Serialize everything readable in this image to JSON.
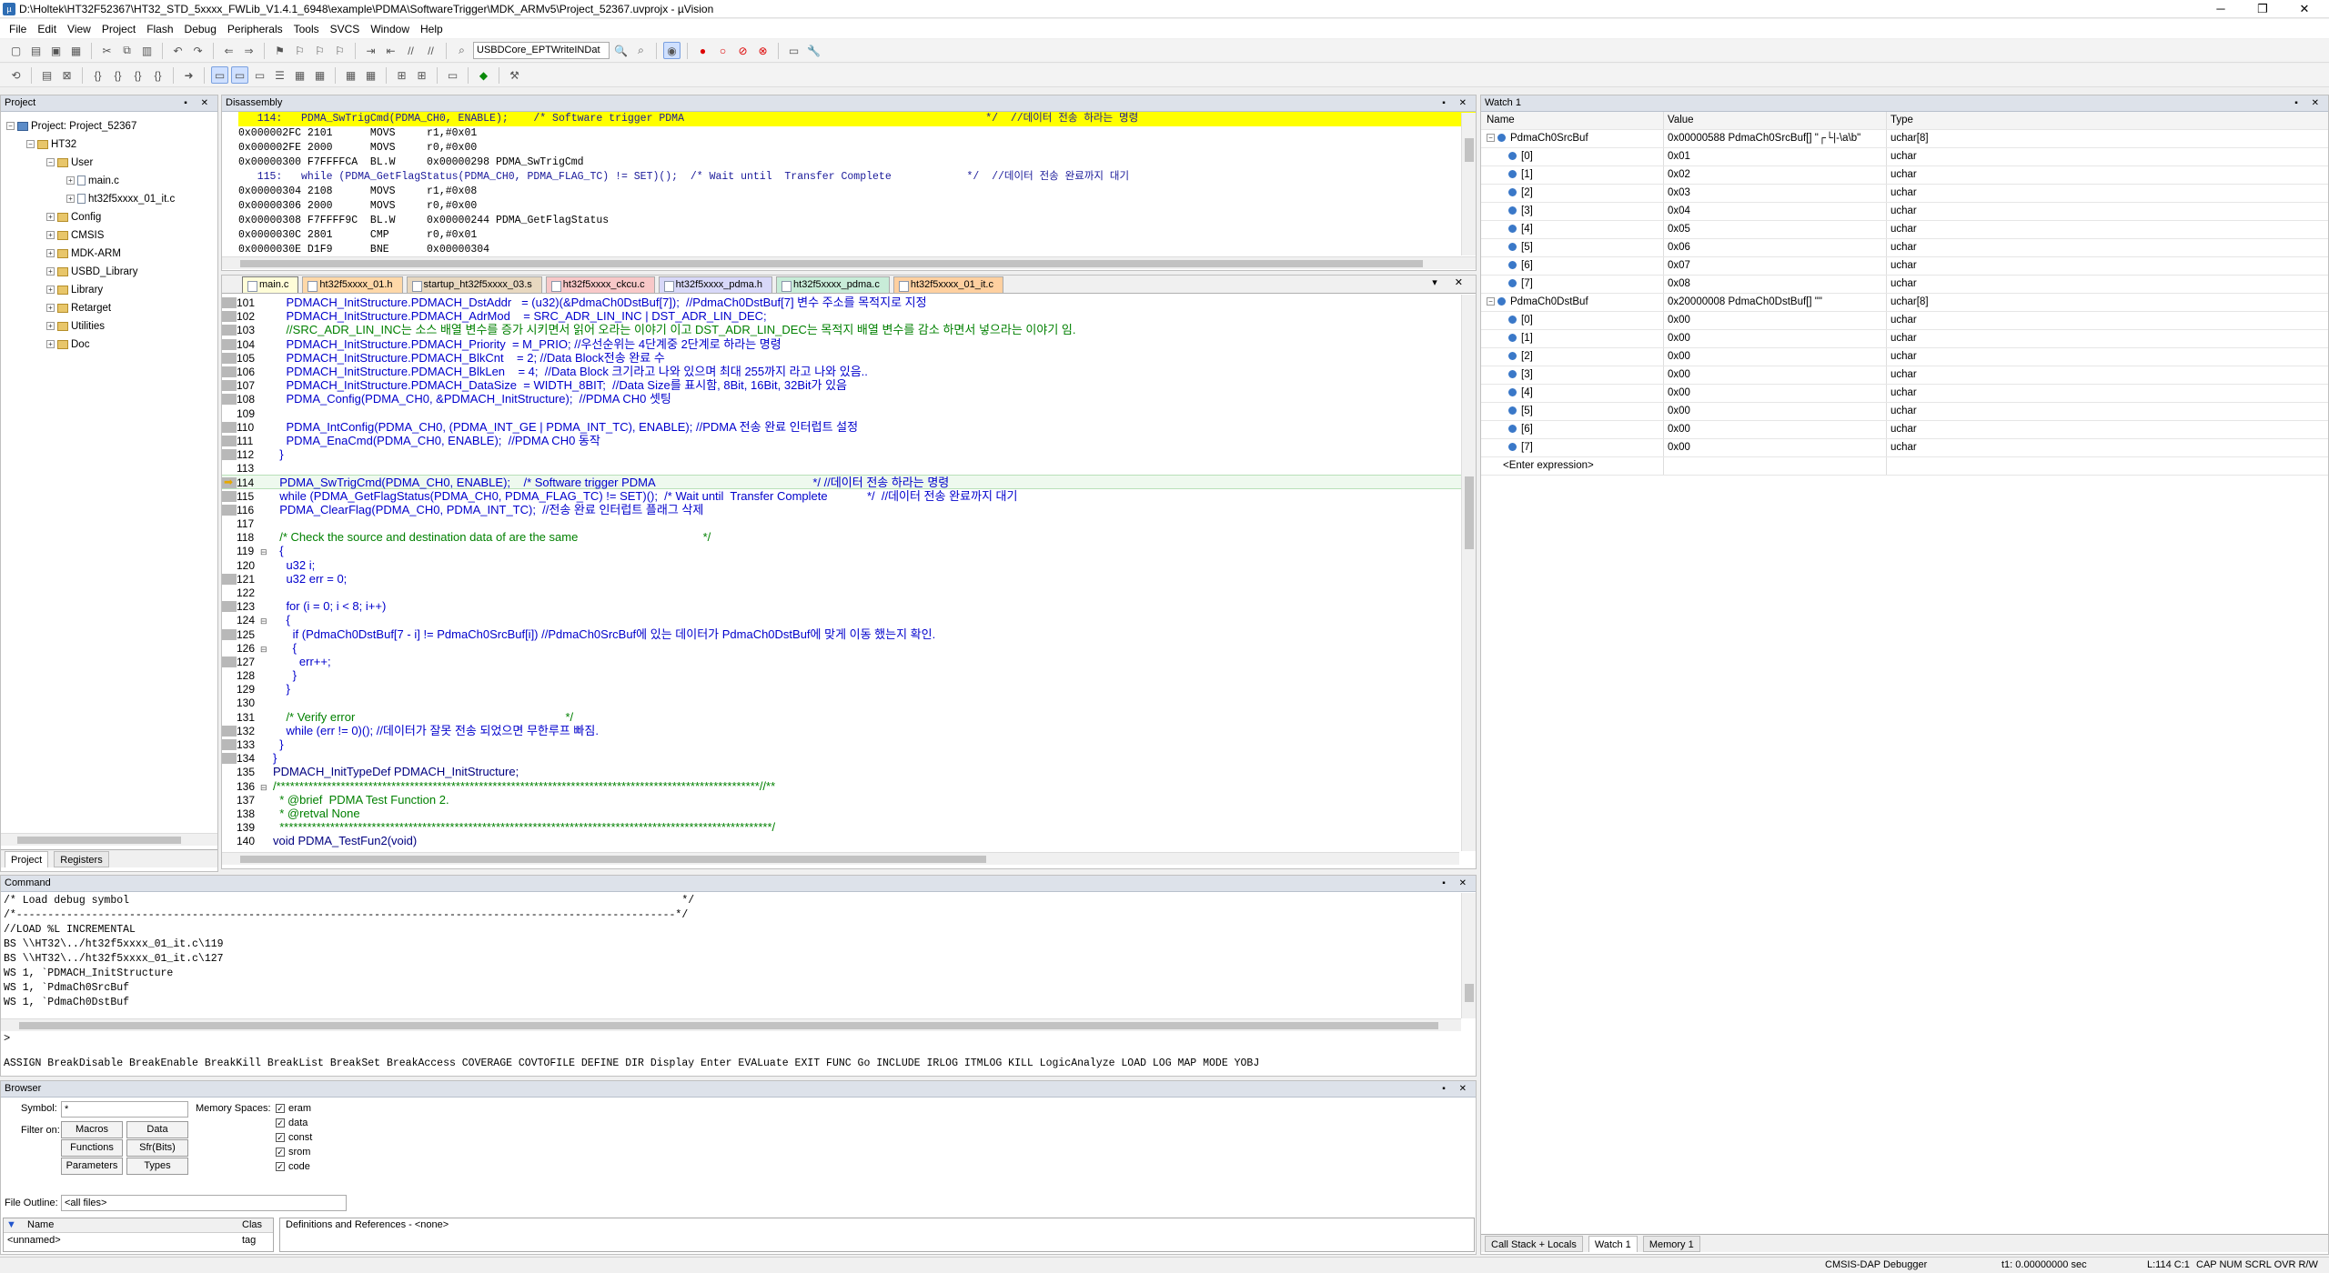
{
  "window": {
    "title": "D:\\Holtek\\HT32F52367\\HT32_STD_5xxxx_FWLib_V1.4.1_6948\\example\\PDMA\\SoftwareTrigger\\MDK_ARMv5\\Project_52367.uvprojx - µVision",
    "minimize": "─",
    "maximize": "❐",
    "close": "✕"
  },
  "menu": [
    "File",
    "Edit",
    "View",
    "Project",
    "Flash",
    "Debug",
    "Peripherals",
    "Tools",
    "SVCS",
    "Window",
    "Help"
  ],
  "toolbar": {
    "target_combo": "USBDCore_EPTWriteINDat"
  },
  "project_pane": {
    "title": "Project",
    "root": "Project: Project_52367",
    "target": "HT32",
    "user_group": "User",
    "files": [
      "main.c",
      "ht32f5xxxx_01_it.c"
    ],
    "groups": [
      "Config",
      "CMSIS",
      "MDK-ARM",
      "USBD_Library",
      "Library",
      "Retarget",
      "Utilities",
      "Doc"
    ],
    "tabs": [
      "Project",
      "Registers"
    ]
  },
  "disassembly": {
    "title": "Disassembly",
    "lines": [
      {
        "text": "   114:   PDMA_SwTrigCmd(PDMA_CH0, ENABLE);    /* Software trigger PDMA                                                */  //데이터 전송 하라는 명령",
        "hl": true
      },
      {
        "text": "0x000002FC 2101      MOVS     r1,#0x01",
        "hl": false,
        "cur": true
      },
      {
        "text": "0x000002FE 2000      MOVS     r0,#0x00",
        "hl": false
      },
      {
        "text": "0x00000300 F7FFFFCA  BL.W     0x00000298 PDMA_SwTrigCmd",
        "hl": false
      },
      {
        "text": "   115:   while (PDMA_GetFlagStatus(PDMA_CH0, PDMA_FLAG_TC) != SET)();  /* Wait until  Transfer Complete            */  //데이터 전송 완료까지 대기",
        "hl": false
      },
      {
        "text": "0x00000304 2108      MOVS     r1,#0x08",
        "hl": false
      },
      {
        "text": "0x00000306 2000      MOVS     r0,#0x00",
        "hl": false
      },
      {
        "text": "0x00000308 F7FFFF9C  BL.W     0x00000244 PDMA_GetFlagStatus",
        "hl": false
      },
      {
        "text": "0x0000030C 2801      CMP      r0,#0x01",
        "hl": false
      },
      {
        "text": "0x0000030E D1F9      BNE      0x00000304",
        "hl": false
      }
    ]
  },
  "editor": {
    "tabs": [
      "main.c",
      "ht32f5xxxx_01.h",
      "startup_ht32f5xxxx_03.s",
      "ht32f5xxxx_ckcu.c",
      "ht32f5xxxx_pdma.h",
      "ht32f5xxxx_pdma.c",
      "ht32f5xxxx_01_it.c"
    ],
    "tab_colors": [
      "#fffdd8",
      "#ffd8a8",
      "#e8d8c0",
      "#f8c8c8",
      "#d8d8f8",
      "#c8ecd8",
      "#ffd0a0"
    ],
    "lines": [
      {
        "n": "101",
        "t": "    PDMACH_InitStructure.PDMACH_DstAddr   = (u32)(&PdmaCh0DstBuf[7]);  //PdmaCh0DstBuf[7] 변수 주소를 목적지로 지정",
        "g": true
      },
      {
        "n": "102",
        "t": "    PDMACH_InitStructure.PDMACH_AdrMod    = SRC_ADR_LIN_INC | DST_ADR_LIN_DEC;",
        "g": true
      },
      {
        "n": "103",
        "t": "    //SRC_ADR_LIN_INC는 소스 배열 변수를 증가 시키면서 읽어 오라는 이야기 이고 DST_ADR_LIN_DEC는 목적지 배열 변수를 감소 하면서 넣으라는 이야기 임.",
        "g": true
      },
      {
        "n": "104",
        "t": "    PDMACH_InitStructure.PDMACH_Priority  = M_PRIO; //우선순위는 4단계중 2단계로 하라는 명령",
        "g": true
      },
      {
        "n": "105",
        "t": "    PDMACH_InitStructure.PDMACH_BlkCnt    = 2; //Data Block전송 완료 수",
        "g": true
      },
      {
        "n": "106",
        "t": "    PDMACH_InitStructure.PDMACH_BlkLen    = 4;  //Data Block 크기라고 나와 있으며 최대 255까지 라고 나와 있음..",
        "g": true
      },
      {
        "n": "107",
        "t": "    PDMACH_InitStructure.PDMACH_DataSize  = WIDTH_8BIT;  //Data Size를 표시함, 8Bit, 16Bit, 32Bit가 있음",
        "g": true
      },
      {
        "n": "108",
        "t": "    PDMA_Config(PDMA_CH0, &PDMACH_InitStructure);  //PDMA CH0 셋팅",
        "g": true
      },
      {
        "n": "109",
        "t": "",
        "g": false
      },
      {
        "n": "110",
        "t": "    PDMA_IntConfig(PDMA_CH0, (PDMA_INT_GE | PDMA_INT_TC), ENABLE); //PDMA 전송 완료 인터럽트 설정",
        "g": true
      },
      {
        "n": "111",
        "t": "    PDMA_EnaCmd(PDMA_CH0, ENABLE);  //PDMA CH0 동작",
        "g": true
      },
      {
        "n": "112",
        "t": "  }",
        "g": true
      },
      {
        "n": "113",
        "t": "",
        "g": false
      },
      {
        "n": "114",
        "t": "  PDMA_SwTrigCmd(PDMA_CH0, ENABLE);    /* Software trigger PDMA                                                */ //데이터 전송 하라는 명령",
        "g": true,
        "cur": true
      },
      {
        "n": "115",
        "t": "  while (PDMA_GetFlagStatus(PDMA_CH0, PDMA_FLAG_TC) != SET)();  /* Wait until  Transfer Complete            */  //데이터 전송 완료까지 대기",
        "g": true
      },
      {
        "n": "116",
        "t": "  PDMA_ClearFlag(PDMA_CH0, PDMA_INT_TC);  //전송 완료 인터럽트 플래그 삭제",
        "g": true
      },
      {
        "n": "117",
        "t": "",
        "g": false
      },
      {
        "n": "118",
        "t": "  /* Check the source and destination data of are the same                                      */",
        "g": false
      },
      {
        "n": "119",
        "t": "  {",
        "g": false,
        "f": true
      },
      {
        "n": "120",
        "t": "    u32 i;",
        "g": false
      },
      {
        "n": "121",
        "t": "    u32 err = 0;",
        "g": true
      },
      {
        "n": "122",
        "t": "",
        "g": false
      },
      {
        "n": "123",
        "t": "    for (i = 0; i < 8; i++)",
        "g": true
      },
      {
        "n": "124",
        "t": "    {",
        "g": false,
        "f": true
      },
      {
        "n": "125",
        "t": "      if (PdmaCh0DstBuf[7 - i] != PdmaCh0SrcBuf[i]) //PdmaCh0SrcBuf에 있는 데이터가 PdmaCh0DstBuf에 맞게 이동 했는지 확인.",
        "g": true
      },
      {
        "n": "126",
        "t": "      {",
        "g": false,
        "f": true
      },
      {
        "n": "127",
        "t": "        err++;",
        "g": true
      },
      {
        "n": "128",
        "t": "      }",
        "g": false
      },
      {
        "n": "129",
        "t": "    }",
        "g": false
      },
      {
        "n": "130",
        "t": "",
        "g": false
      },
      {
        "n": "131",
        "t": "    /* Verify error                                                                */",
        "g": false
      },
      {
        "n": "132",
        "t": "    while (err != 0)(); //데이터가 잘못 전송 되었으면 무한루프 빠짐.",
        "g": true
      },
      {
        "n": "133",
        "t": "  }",
        "g": true
      },
      {
        "n": "134",
        "t": "}",
        "g": true
      },
      {
        "n": "135",
        "t": "PDMACH_InitTypeDef PDMACH_InitStructure;",
        "g": false
      },
      {
        "n": "136",
        "t": "/*********************************************************************************************************//**",
        "g": false,
        "f": true
      },
      {
        "n": "137",
        "t": "  * @brief  PDMA Test Function 2.",
        "g": false
      },
      {
        "n": "138",
        "t": "  * @retval None",
        "g": false
      },
      {
        "n": "139",
        "t": "  ***********************************************************************************************************/",
        "g": false
      },
      {
        "n": "140",
        "t": "void PDMA_TestFun2(void)",
        "g": false
      }
    ]
  },
  "watch": {
    "title": "Watch 1",
    "headers": [
      "Name",
      "Value",
      "Type"
    ],
    "rows": [
      {
        "name": "PdmaCh0SrcBuf",
        "value": "0x00000588 PdmaCh0SrcBuf[] \"┌└|-\\a\\b\"",
        "type": "uchar[8]",
        "lvl": 0
      },
      {
        "name": "[0]",
        "value": "0x01",
        "type": "uchar",
        "lvl": 1
      },
      {
        "name": "[1]",
        "value": "0x02",
        "type": "uchar",
        "lvl": 1
      },
      {
        "name": "[2]",
        "value": "0x03",
        "type": "uchar",
        "lvl": 1
      },
      {
        "name": "[3]",
        "value": "0x04",
        "type": "uchar",
        "lvl": 1
      },
      {
        "name": "[4]",
        "value": "0x05",
        "type": "uchar",
        "lvl": 1
      },
      {
        "name": "[5]",
        "value": "0x06",
        "type": "uchar",
        "lvl": 1
      },
      {
        "name": "[6]",
        "value": "0x07",
        "type": "uchar",
        "lvl": 1
      },
      {
        "name": "[7]",
        "value": "0x08",
        "type": "uchar",
        "lvl": 1
      },
      {
        "name": "PdmaCh0DstBuf",
        "value": "0x20000008 PdmaCh0DstBuf[] \"\"",
        "type": "uchar[8]",
        "lvl": 0
      },
      {
        "name": "[0]",
        "value": "0x00",
        "type": "uchar",
        "lvl": 1
      },
      {
        "name": "[1]",
        "value": "0x00",
        "type": "uchar",
        "lvl": 1
      },
      {
        "name": "[2]",
        "value": "0x00",
        "type": "uchar",
        "lvl": 1
      },
      {
        "name": "[3]",
        "value": "0x00",
        "type": "uchar",
        "lvl": 1
      },
      {
        "name": "[4]",
        "value": "0x00",
        "type": "uchar",
        "lvl": 1
      },
      {
        "name": "[5]",
        "value": "0x00",
        "type": "uchar",
        "lvl": 1
      },
      {
        "name": "[6]",
        "value": "0x00",
        "type": "uchar",
        "lvl": 1
      },
      {
        "name": "[7]",
        "value": "0x00",
        "type": "uchar",
        "lvl": 1
      }
    ],
    "enter_expression": "<Enter expression>",
    "bottom_tabs": [
      "Call Stack + Locals",
      "Watch 1",
      "Memory 1"
    ]
  },
  "command": {
    "title": "Command",
    "lines": [
      "/* Load debug symbol                                                                                        */",
      "/*---------------------------------------------------------------------------------------------------------*/",
      "//LOAD %L INCREMENTAL",
      "BS \\\\HT32\\../ht32f5xxxx_01_it.c\\119",
      "BS \\\\HT32\\../ht32f5xxxx_01_it.c\\127",
      "WS 1, `PDMACH_InitStructure",
      "WS 1, `PdmaCh0SrcBuf",
      "WS 1, `PdmaCh0DstBuf"
    ],
    "prompt": ">",
    "keywords": "ASSIGN BreakDisable BreakEnable BreakKill BreakList BreakSet BreakAccess COVERAGE COVTOFILE DEFINE DIR Display Enter EVALuate EXIT FUNC Go INCLUDE IRLOG ITMLOG KILL LogicAnalyze LOAD LOG MAP MODE YOBJ"
  },
  "browser": {
    "title": "Browser",
    "symbol_label": "Symbol:",
    "symbol_value": "*",
    "memory_label": "Memory Spaces:",
    "filter_label": "Filter on:",
    "filter_buttons": [
      "Macros",
      "Data",
      "Functions",
      "Sfr(Bits)",
      "Parameters",
      "Types"
    ],
    "memory_spaces": [
      "eram",
      "data",
      "const",
      "srom",
      "code"
    ],
    "file_outline_label": "File Outline:",
    "file_outline_value": "<all files>",
    "col_name": "Name",
    "col_class": "Clas",
    "row_name": "<unnamed>",
    "row_class": "tag",
    "definitions": "Definitions and References - <none>"
  },
  "status": {
    "debugger": "CMSIS-DAP Debugger",
    "time": "t1: 0.00000000 sec",
    "pos": "L:114 C:1",
    "flags": "CAP  NUM  SCRL  OVR  R/W"
  }
}
